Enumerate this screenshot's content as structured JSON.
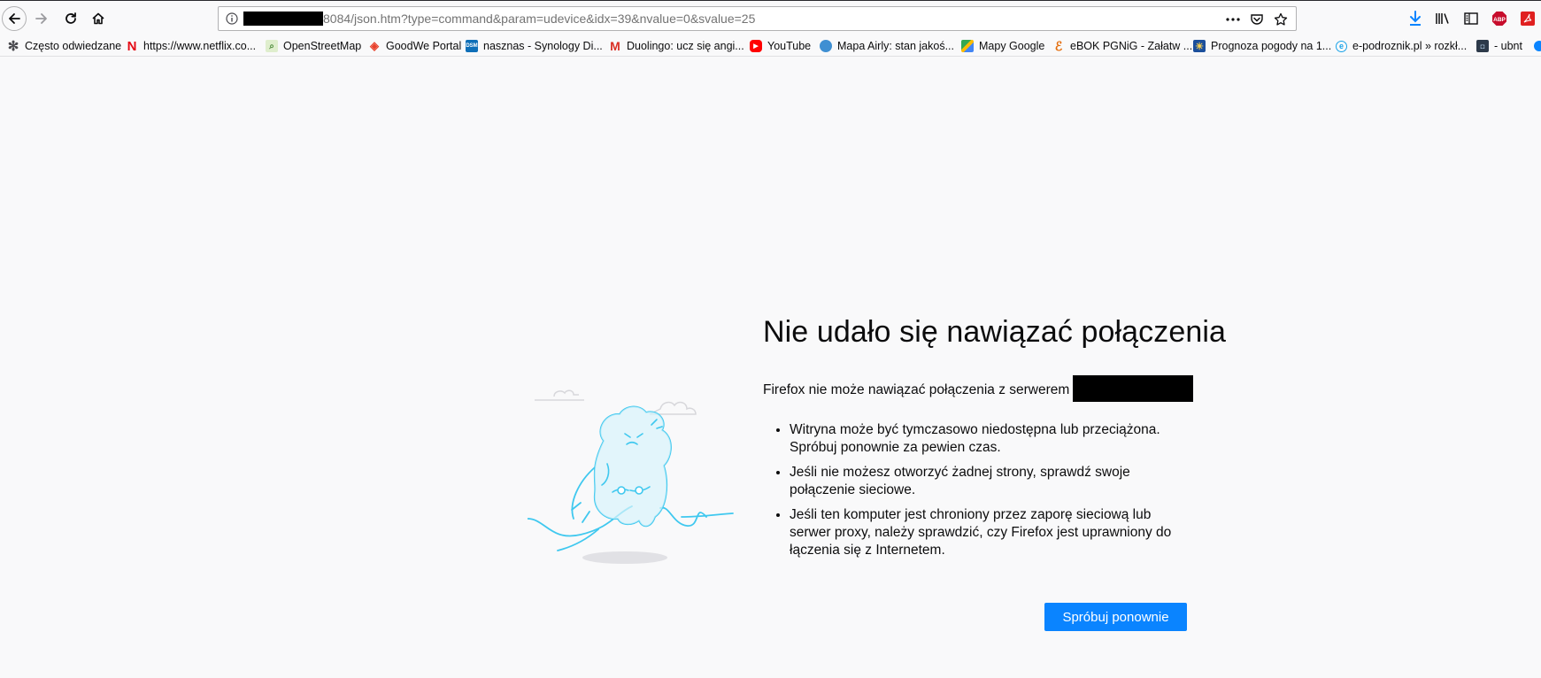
{
  "toolbar": {
    "url_visible": "8084/json.htm?type=command&param=udevice&idx=39&nvalue=0&svalue=25",
    "buttons": [
      "back-icon",
      "forward-icon",
      "reload-icon",
      "home-icon"
    ]
  },
  "bookmarks": [
    {
      "label": "Często odwiedzane",
      "icon": "gear-icon",
      "color": "#4a4a4f"
    },
    {
      "label": "https://www.netflix.co...",
      "icon": "netflix-icon",
      "color": "#e50914",
      "glyph": "N"
    },
    {
      "label": "OpenStreetMap",
      "icon": "osm-icon",
      "color": "#7ebc6f",
      "glyph": "⌕"
    },
    {
      "label": "GoodWe Portal",
      "icon": "goodwe-icon",
      "color": "#e8412c",
      "glyph": "◈"
    },
    {
      "label": "nasznas - Synology Di...",
      "icon": "dsm-icon",
      "color": "#0f6fb8",
      "glyph": "DSM"
    },
    {
      "label": "Duolingo: ucz się angi...",
      "icon": "gmail-icon",
      "color": "#d93025",
      "glyph": "M"
    },
    {
      "label": "YouTube",
      "icon": "youtube-icon",
      "color": "#ff0000",
      "glyph": "▶"
    },
    {
      "label": "Mapa Airly: stan jakoś...",
      "icon": "airly-icon",
      "color": "#3f8fd2",
      "glyph": "●"
    },
    {
      "label": "Mapy Google",
      "icon": "google-maps-icon",
      "color": "#34a853",
      "glyph": "◆"
    },
    {
      "label": "eBOK PGNiG - Załatw ...",
      "icon": "pgnig-icon",
      "color": "#e46c0a",
      "glyph": "ℰ"
    },
    {
      "label": "Prognoza pogody na 1...",
      "icon": "weather-icon",
      "color": "#1b4f9c",
      "glyph": "☀"
    },
    {
      "label": "e-podroznik.pl » rozkł...",
      "icon": "epodroznik-icon",
      "color": "#1aa3e8",
      "glyph": "e"
    },
    {
      "label": "- ubnt",
      "icon": "ubnt-icon",
      "color": "#2d3a4a",
      "glyph": "◘"
    }
  ],
  "error": {
    "title": "Nie udało się nawiązać połączenia",
    "description": "Firefox nie może nawiązać połączenia z serwerem",
    "items": [
      "Witryna może być tymczasowo niedostępna lub przeciążona. Spróbuj ponownie za pewien czas.",
      "Jeśli nie możesz otworzyć żadnej strony, sprawdź swoje połączenie sieciowe.",
      "Jeśli ten komputer jest chroniony przez zaporę sieciową lub serwer proxy, należy sprawdzić, czy Firefox jest uprawniony do łączenia się z Internetem."
    ],
    "retry_label": "Spróbuj ponownie"
  },
  "colors": {
    "accent": "#0a84ff",
    "download": "#0a84ff",
    "abp": "#c70d2c",
    "illustration": "#3fc8ef"
  }
}
